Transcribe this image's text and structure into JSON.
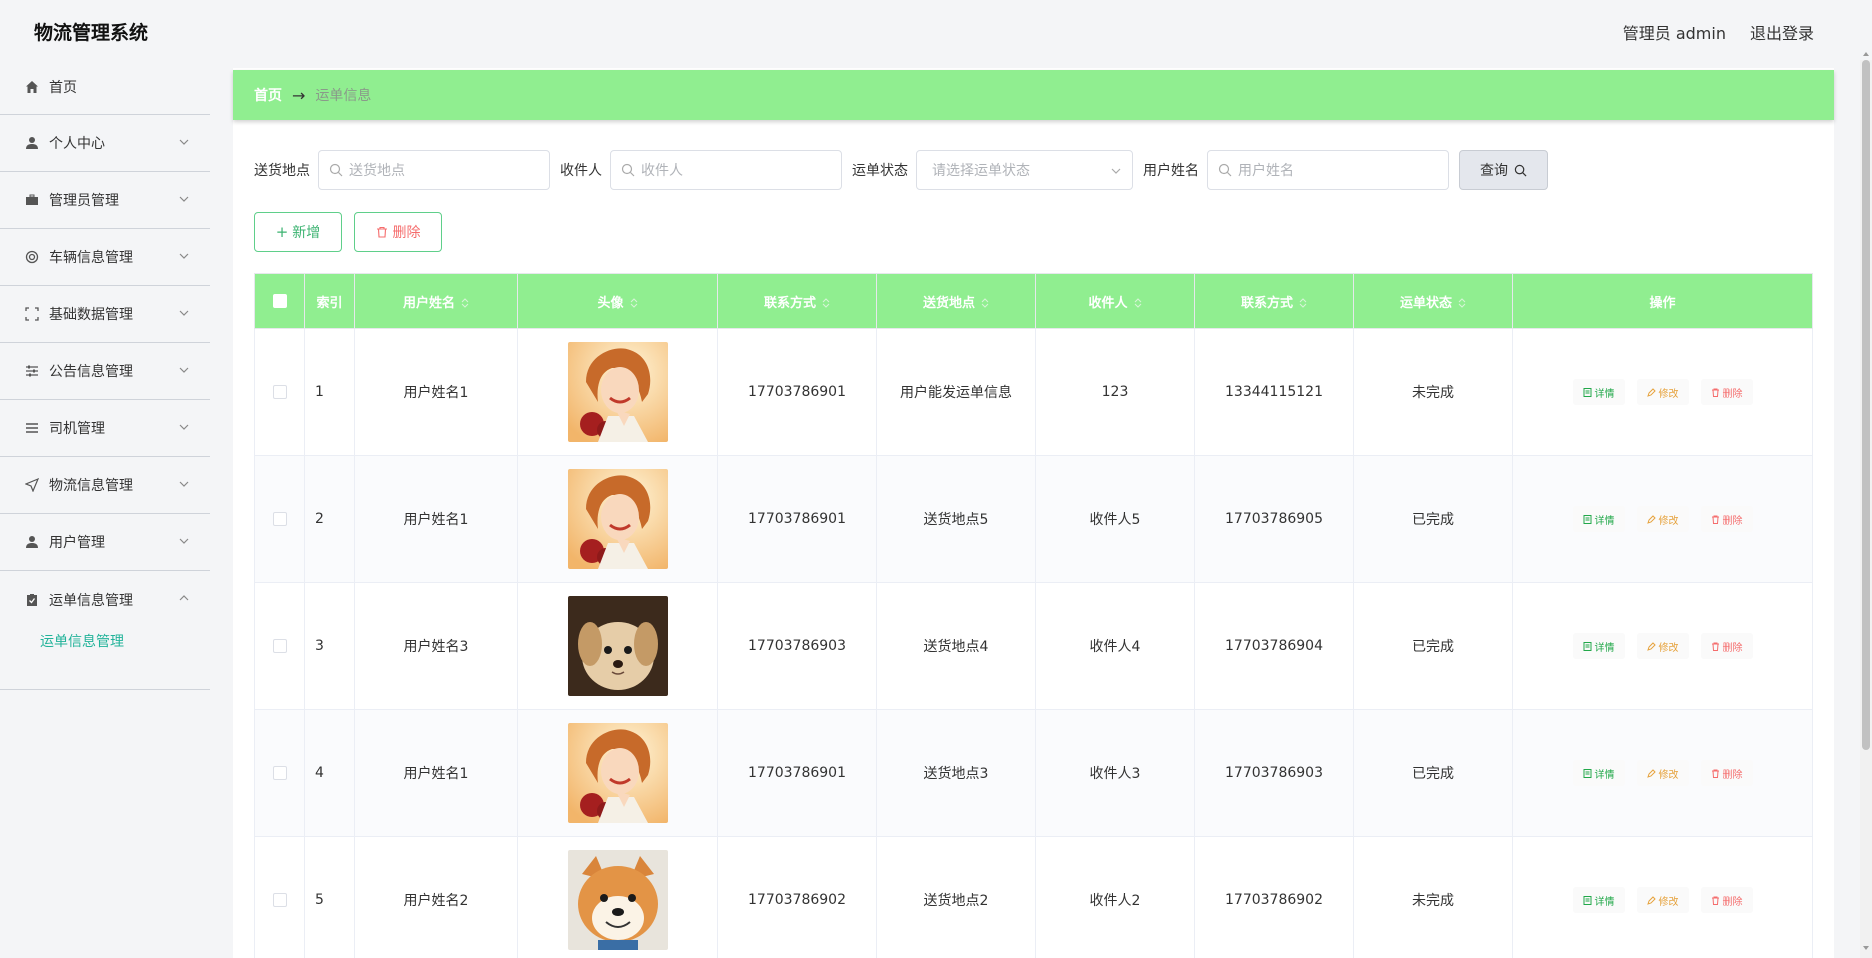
{
  "header": {
    "title": "物流管理系统",
    "user_label": "管理员 admin",
    "logout_label": "退出登录"
  },
  "sidebar": {
    "items": [
      {
        "label": "首页",
        "icon": "home-icon"
      },
      {
        "label": "个人中心",
        "icon": "user-icon"
      },
      {
        "label": "管理员管理",
        "icon": "briefcase-icon"
      },
      {
        "label": "车辆信息管理",
        "icon": "lifebuoy-icon"
      },
      {
        "label": "基础数据管理",
        "icon": "frame-icon"
      },
      {
        "label": "公告信息管理",
        "icon": "sliders-icon"
      },
      {
        "label": "司机管理",
        "icon": "list-icon"
      },
      {
        "label": "物流信息管理",
        "icon": "send-icon"
      },
      {
        "label": "用户管理",
        "icon": "user-icon"
      },
      {
        "label": "运单信息管理",
        "icon": "clipboard-check-icon"
      }
    ],
    "submenu_label": "运单信息管理"
  },
  "breadcrumb": {
    "home": "首页",
    "arrow": "→",
    "current": "运单信息"
  },
  "search": {
    "address_label": "送货地点",
    "address_placeholder": "送货地点",
    "receiver_label": "收件人",
    "receiver_placeholder": "收件人",
    "status_label": "运单状态",
    "status_placeholder": "请选择运单状态",
    "username_label": "用户姓名",
    "username_placeholder": "用户姓名",
    "query_label": "查询"
  },
  "actions": {
    "add_label": "新增",
    "delete_label": "删除"
  },
  "table": {
    "headers": [
      "索引",
      "用户姓名",
      "头像",
      "联系方式",
      "送货地点",
      "收件人",
      "联系方式",
      "运单状态",
      "操作"
    ],
    "rows": [
      {
        "index": "1",
        "username": "用户姓名1",
        "avatar": "woman-photo",
        "phone": "17703786901",
        "address": "用户能发运单信息",
        "receiver": "123",
        "receiver_phone": "13344115121",
        "status": "未完成"
      },
      {
        "index": "2",
        "username": "用户姓名1",
        "avatar": "woman-photo",
        "phone": "17703786901",
        "address": "送货地点5",
        "receiver": "收件人5",
        "receiver_phone": "17703786905",
        "status": "已完成"
      },
      {
        "index": "3",
        "username": "用户姓名3",
        "avatar": "puppy-photo",
        "phone": "17703786903",
        "address": "送货地点4",
        "receiver": "收件人4",
        "receiver_phone": "17703786904",
        "status": "已完成"
      },
      {
        "index": "4",
        "username": "用户姓名1",
        "avatar": "woman-photo",
        "phone": "17703786901",
        "address": "送货地点3",
        "receiver": "收件人3",
        "receiver_phone": "17703786903",
        "status": "已完成"
      },
      {
        "index": "5",
        "username": "用户姓名2",
        "avatar": "shiba-photo",
        "phone": "17703786902",
        "address": "送货地点2",
        "receiver": "收件人2",
        "receiver_phone": "17703786902",
        "status": "未完成"
      }
    ],
    "op_detail": "详情",
    "op_edit": "修改",
    "op_delete": "删除"
  },
  "colors": {
    "accent_green": "#90ee90",
    "teal": "#22b39a",
    "danger": "#f56c6c",
    "warning": "#e6a23c"
  }
}
